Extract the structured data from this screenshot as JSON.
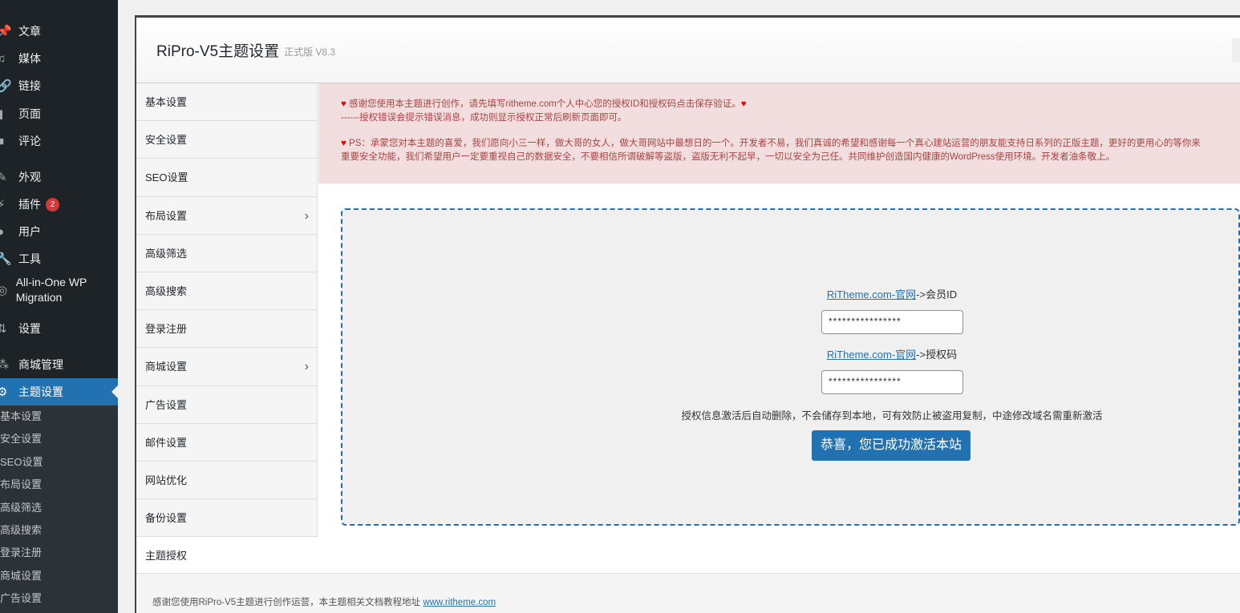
{
  "admin_menu": [
    {
      "label": "文章",
      "icon": "pin-icon"
    },
    {
      "label": "媒体",
      "icon": "media-icon"
    },
    {
      "label": "链接",
      "icon": "link-icon"
    },
    {
      "label": "页面",
      "icon": "page-icon"
    },
    {
      "label": "评论",
      "icon": "comment-icon"
    },
    {
      "label": "外观",
      "icon": "brush-icon"
    },
    {
      "label": "插件",
      "icon": "plugin-icon",
      "badge": "2"
    },
    {
      "label": "用户",
      "icon": "user-icon"
    },
    {
      "label": "工具",
      "icon": "wrench-icon"
    },
    {
      "label": "All-in-One WP Migration",
      "icon": "migration-icon"
    },
    {
      "label": "设置",
      "icon": "settings-icon"
    },
    {
      "label": "商城管理",
      "icon": "shop-icon"
    },
    {
      "label": "主题设置",
      "icon": "gear-icon"
    }
  ],
  "submenu": [
    "基本设置",
    "安全设置",
    "SEO设置",
    "布局设置",
    "高级筛选",
    "高级搜索",
    "登录注册",
    "商城设置",
    "广告设置"
  ],
  "header": {
    "title": "RiPro-V5主题设置",
    "version": "正式版 V8.3"
  },
  "nav": [
    {
      "label": "基本设置"
    },
    {
      "label": "安全设置"
    },
    {
      "label": "SEO设置"
    },
    {
      "label": "布局设置",
      "chevron": true
    },
    {
      "label": "高级筛选"
    },
    {
      "label": "高级搜索"
    },
    {
      "label": "登录注册"
    },
    {
      "label": "商城设置",
      "chevron": true
    },
    {
      "label": "广告设置"
    },
    {
      "label": "邮件设置"
    },
    {
      "label": "网站优化"
    },
    {
      "label": "备份设置"
    },
    {
      "label": "主题授权",
      "current": true
    }
  ],
  "notice": {
    "line1": "感谢您使用本主题进行创作，请先填写ritheme.com个人中心您的授权ID和授权码点击保存验证。",
    "line2": "------授权错误会提示错误消息，成功则显示授权正常后刷新页面即可。",
    "line3": "PS：承蒙您对本主题的喜爱，我们愿向小三一样，做大哥的女人，做大哥网站中最想日的一个。开发者不易，我们真诚的希望和感谢每一个真心建站运营的朋友能支持日系列的正版主题，更好的更用心的等你来",
    "line4": "重要安全功能，我们希望用户一定要重视自己的数据安全，不要相信所谓破解等盗版，盗版无利不起早，一切以安全为己任。共同维护创造国内健康的WordPress使用环境。开发者油条敬上。"
  },
  "license": {
    "link_text": "RiTheme.com-官网",
    "id_label": "->会员ID",
    "id_value": "****************",
    "code_label": "->授权码",
    "code_value": "****************",
    "hint": "授权信息激活后自动删除，不会储存到本地，可有效防止被盗用复制，中途修改域名需重新激活",
    "button": "恭喜，您已成功激活本站"
  },
  "footer": {
    "text": "感谢您使用RiPro-V5主题进行创作运营，本主题相关文档教程地址 ",
    "link": "www.ritheme.com"
  }
}
